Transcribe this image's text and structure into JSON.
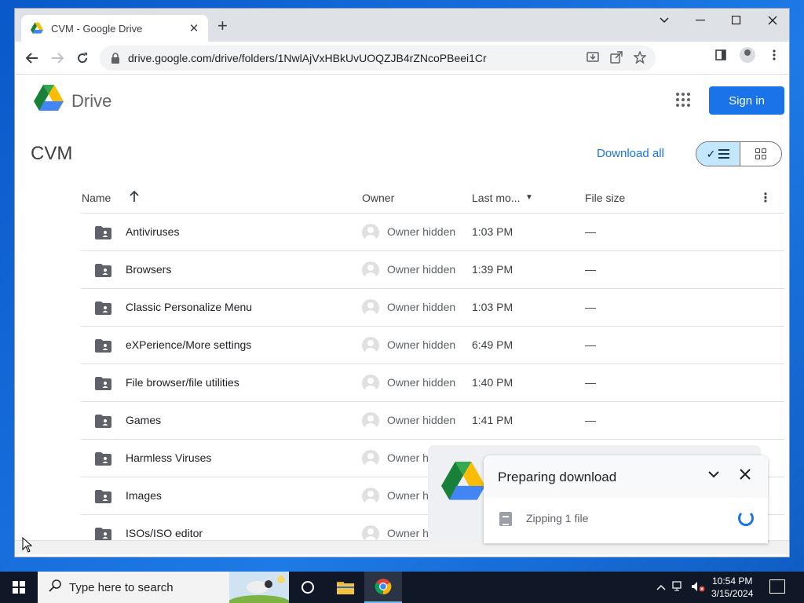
{
  "browser": {
    "tab_title": "CVM - Google Drive",
    "url": "drive.google.com/drive/folders/1NwlAjVxHBkUvUOQZJB4rZNcoPBeei1Cr"
  },
  "drive": {
    "app_name": "Drive",
    "signin_label": "Sign in",
    "folder_title": "CVM",
    "download_all_label": "Download all"
  },
  "table": {
    "columns": {
      "name": "Name",
      "owner": "Owner",
      "modified": "Last mo...",
      "size": "File size"
    },
    "rows": [
      {
        "name": "Antiviruses",
        "owner": "Owner hidden",
        "modified": "1:03 PM",
        "size": "—"
      },
      {
        "name": "Browsers",
        "owner": "Owner hidden",
        "modified": "1:39 PM",
        "size": "—"
      },
      {
        "name": "Classic Personalize Menu",
        "owner": "Owner hidden",
        "modified": "1:03 PM",
        "size": "—"
      },
      {
        "name": "eXPerience/More settings",
        "owner": "Owner hidden",
        "modified": "6:49 PM",
        "size": "—"
      },
      {
        "name": "File browser/file utilities",
        "owner": "Owner hidden",
        "modified": "1:40 PM",
        "size": "—"
      },
      {
        "name": "Games",
        "owner": "Owner hidden",
        "modified": "1:41 PM",
        "size": "—"
      },
      {
        "name": "Harmless Viruses",
        "owner": "Owner hidde",
        "modified": "",
        "size": ""
      },
      {
        "name": "Images",
        "owner": "Owner hidde",
        "modified": "",
        "size": ""
      },
      {
        "name": "ISOs/ISO editor",
        "owner": "Owner hidden",
        "modified": "",
        "size": ""
      }
    ]
  },
  "download_toast": {
    "title": "Preparing download",
    "item": "Zipping 1 file"
  },
  "taskbar": {
    "search_placeholder": "Type here to search",
    "time": "10:54 PM",
    "date": "3/15/2024"
  },
  "colors": {
    "accent": "#1a73e8",
    "toggle_active": "#c2e7ff",
    "taskbar": "#101827",
    "desktop": "#1665c9"
  }
}
